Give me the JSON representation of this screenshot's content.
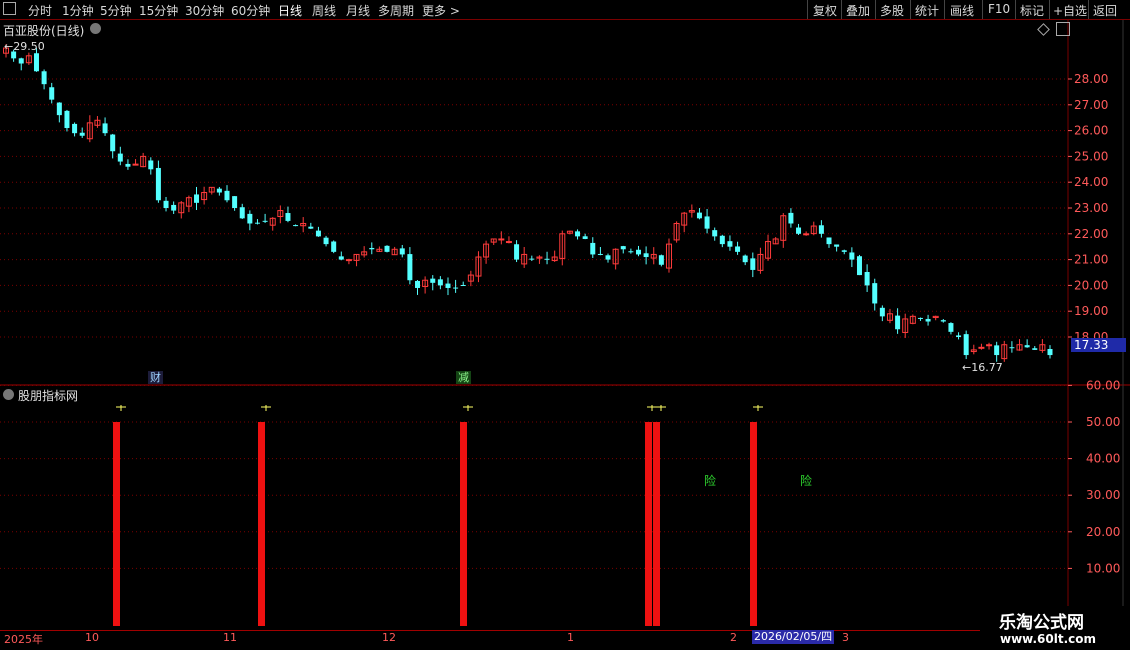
{
  "toolbar": {
    "left_items": [
      "分时",
      "1分钟",
      "5分钟",
      "15分钟",
      "30分钟",
      "60分钟",
      "日线",
      "周线",
      "月线",
      "多周期",
      "更多 >"
    ],
    "active": "日线",
    "right_items": [
      "复权",
      "叠加",
      "多股",
      "统计",
      "画线",
      "F10",
      "标记",
      "+自选",
      "返回"
    ]
  },
  "main_panel": {
    "title": "百亚股份(日线)",
    "high_label": "29.50",
    "low_label": "16.77",
    "current_price": "17.33",
    "axis_ticks": [
      "28.00",
      "27.00",
      "26.00",
      "25.00",
      "24.00",
      "23.00",
      "22.00",
      "21.00",
      "20.00",
      "19.00",
      "18.00"
    ],
    "event_tags": [
      "财",
      "减"
    ]
  },
  "indicator_panel": {
    "title": "股朋指标网",
    "axis_ticks": [
      "60.00",
      "50.00",
      "40.00",
      "30.00",
      "20.00",
      "10.00"
    ],
    "warning_labels": [
      "险",
      "险"
    ]
  },
  "date_axis": {
    "labels": [
      "2025年",
      "10",
      "11",
      "12",
      "1",
      "2",
      "3"
    ],
    "cursor_date": "2026/02/05/四"
  },
  "watermark": {
    "name": "乐淘公式网",
    "url": "www.60lt.com"
  },
  "chart_data": [
    {
      "type": "candlestick",
      "title": "百亚股份(日线)",
      "ylim": [
        16.5,
        29.8
      ],
      "high": 29.5,
      "low": 16.77,
      "last": 17.33,
      "close_series": [
        29.2,
        28.8,
        28.6,
        28.9,
        28.3,
        27.8,
        27.2,
        26.6,
        26.1,
        25.9,
        25.8,
        26.3,
        26.4,
        25.9,
        25.2,
        24.8,
        24.6,
        24.7,
        25.0,
        24.5,
        23.3,
        23.0,
        22.9,
        23.2,
        23.4,
        23.2,
        23.6,
        23.8,
        23.6,
        23.3,
        23.0,
        22.6,
        22.4,
        22.4,
        22.5,
        22.6,
        22.9,
        22.5,
        22.3,
        22.4,
        22.2,
        21.9,
        21.6,
        21.3,
        21.0,
        21.0,
        21.2,
        21.3,
        21.4,
        21.4,
        21.3,
        21.4,
        21.2,
        20.2,
        19.9,
        20.2,
        20.1,
        20.0,
        19.9,
        19.9,
        20.0,
        20.4,
        21.1,
        21.6,
        21.8,
        21.8,
        21.7,
        21.0,
        21.2,
        21.0,
        21.1,
        21.0,
        21.1,
        22.0,
        22.1,
        21.9,
        21.8,
        21.2,
        21.2,
        21.0,
        21.4,
        21.4,
        21.3,
        21.2,
        21.1,
        21.2,
        20.8,
        21.6,
        22.4,
        22.8,
        22.9,
        22.6,
        22.2,
        21.9,
        21.6,
        21.5,
        21.3,
        20.9,
        20.6,
        21.2,
        21.7,
        21.8,
        22.7,
        22.4,
        22.0,
        22.0,
        22.3,
        22.0,
        21.6,
        21.5,
        21.3,
        21.0,
        20.4,
        20.0,
        19.3,
        18.8,
        18.9,
        18.3,
        18.7,
        18.8,
        18.7,
        18.6,
        18.8,
        18.6,
        18.2,
        18.0,
        17.3,
        17.5,
        17.6,
        17.7,
        17.3,
        17.7,
        17.6,
        17.7,
        17.6,
        17.5,
        17.7,
        17.3
      ]
    },
    {
      "type": "bar",
      "title": "股朋指标网",
      "ylim": [
        0,
        65
      ],
      "series": [
        {
          "values": [
            50,
            50,
            50,
            50,
            50,
            50
          ]
        }
      ]
    }
  ],
  "colors": {
    "up": "#ff3b3b",
    "down": "#54ffff",
    "signal_bar": "#ee1111",
    "grid": "#7a0000",
    "axis_text": "#ff5a5a",
    "cross_marker": "#ffff66",
    "warning": "#2fd62f",
    "price_label_bg": "#1f2aa8"
  }
}
